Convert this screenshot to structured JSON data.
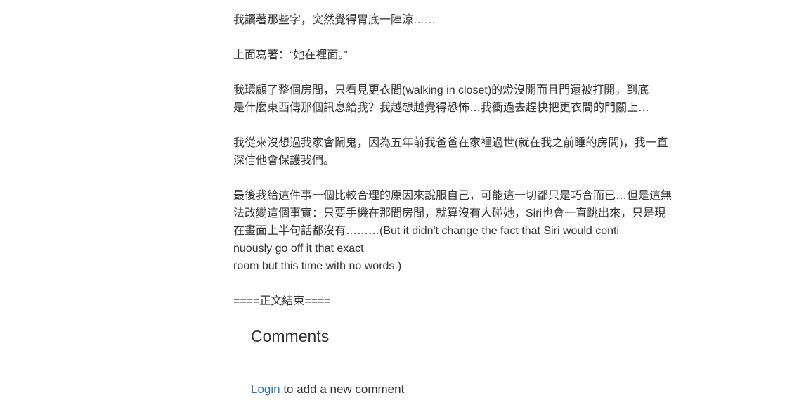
{
  "article": {
    "paragraphs": [
      "我讀著那些字，突然覺得胃底一陣涼……",
      "上面寫著：“她在裡面。”",
      "我環顧了整個房間，只看見更衣間(walking in closet)的燈沒開而且門還被打開。到底\n是什麼東西傳那個訊息給我？我越想越覺得恐怖…我衝過去趕快把更衣間的門關上…",
      "我從來沒想過我家會鬧鬼，因為五年前我爸爸在家裡過世(就在我之前睡的房間)，我一直\n深信他會保護我們。",
      "最後我給這件事一個比較合理的原因來說服自己，可能這一切都只是巧合而已…但是這無\n法改變這個事實：只要手機在那間房間，就算沒有人碰她，Siri也會一直跳出來，只是現\n在畫面上半句話都沒有………(But it didn't change the fact that Siri would conti\nnuously go off it that exact\n room but this time with no words.)",
      "====正文結束===="
    ]
  },
  "comments": {
    "title": "Comments",
    "login_link": "Login",
    "login_suffix": " to add a new comment"
  }
}
